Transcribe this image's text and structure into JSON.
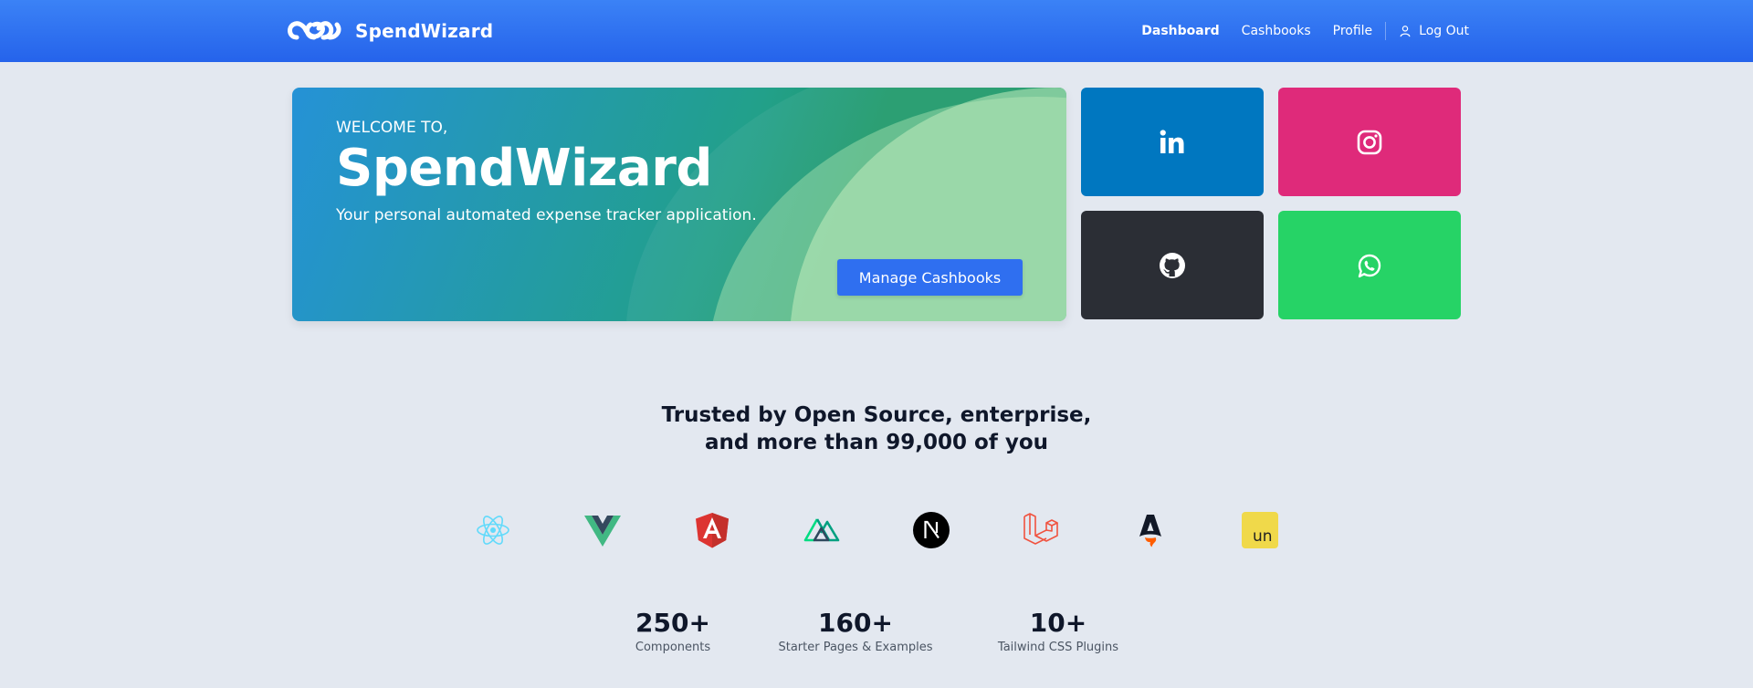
{
  "header": {
    "brand": "SpendWizard",
    "nav": [
      {
        "label": "Dashboard",
        "active": true
      },
      {
        "label": "Cashbooks",
        "active": false
      },
      {
        "label": "Profile",
        "active": false
      }
    ],
    "logout_label": "Log Out"
  },
  "hero": {
    "welcome": "WELCOME TO,",
    "title": "SpendWizard",
    "subtitle": "Your personal automated expense tracker application.",
    "button_label": "Manage Cashbooks"
  },
  "social": [
    {
      "name": "linkedin-icon",
      "color": "#0077c0"
    },
    {
      "name": "instagram-icon",
      "color": "#df2a7a"
    },
    {
      "name": "github-icon",
      "color": "#2b2e35"
    },
    {
      "name": "whatsapp-icon",
      "color": "#26d366"
    }
  ],
  "trusted": {
    "line1": "Trusted by Open Source, enterprise,",
    "line2": "and more than 99,000 of you"
  },
  "logos": [
    "react-icon",
    "vue-icon",
    "angular-icon",
    "nuxt-icon",
    "nextjs-icon",
    "laravel-icon",
    "astro-icon",
    "unocss-icon"
  ],
  "unocss_text": "un",
  "stats": [
    {
      "num": "250+",
      "label": "Components"
    },
    {
      "num": "160+",
      "label": "Starter Pages & Examples"
    },
    {
      "num": "10+",
      "label": "Tailwind CSS Plugins"
    }
  ],
  "colors": {
    "header": "#2563eb",
    "background": "#e3e8f0",
    "button": "#2f6ff0"
  }
}
